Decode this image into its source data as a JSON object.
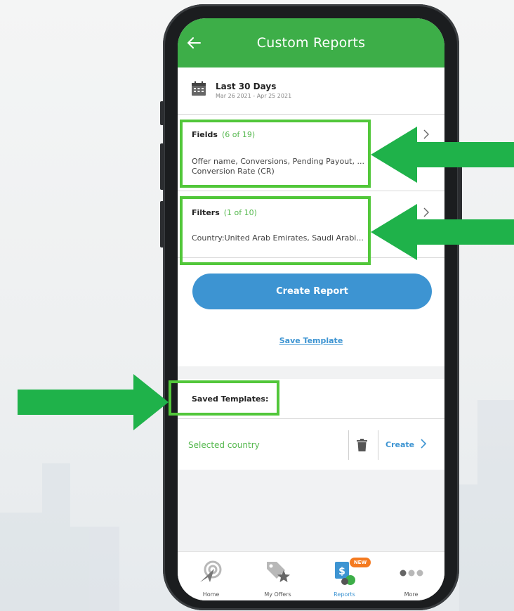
{
  "header": {
    "title": "Custom Reports"
  },
  "date_range": {
    "label": "Last 30 Days",
    "range": "Mar 26 2021 - Apr 25 2021"
  },
  "fields": {
    "title": "Fields",
    "count": "(6 of 19)",
    "line1": "Offer name, Conversions, Pending Payout, ...",
    "line2": "Conversion Rate (CR)"
  },
  "filters": {
    "title": "Filters",
    "count": "(1 of 10)",
    "line1": "Country:United Arab Emirates, Saudi Arabi..."
  },
  "actions": {
    "create_report": "Create Report",
    "save_template": "Save Template"
  },
  "saved_templates": {
    "title": "Saved Templates:",
    "items": [
      {
        "name": "Selected country",
        "create_label": "Create"
      }
    ]
  },
  "bottom_nav": {
    "items": [
      {
        "label": "Home",
        "icon": "home-icon"
      },
      {
        "label": "My Offers",
        "icon": "offers-icon"
      },
      {
        "label": "Reports",
        "icon": "reports-icon",
        "active": true,
        "badge": "NEW"
      },
      {
        "label": "More",
        "icon": "more-icon"
      }
    ]
  },
  "colors": {
    "header_green": "#3dae48",
    "accent_blue": "#3d94d2",
    "highlight_green": "#52c73a",
    "arrow_green": "#1fb24a",
    "badge_orange": "#f47a20"
  }
}
